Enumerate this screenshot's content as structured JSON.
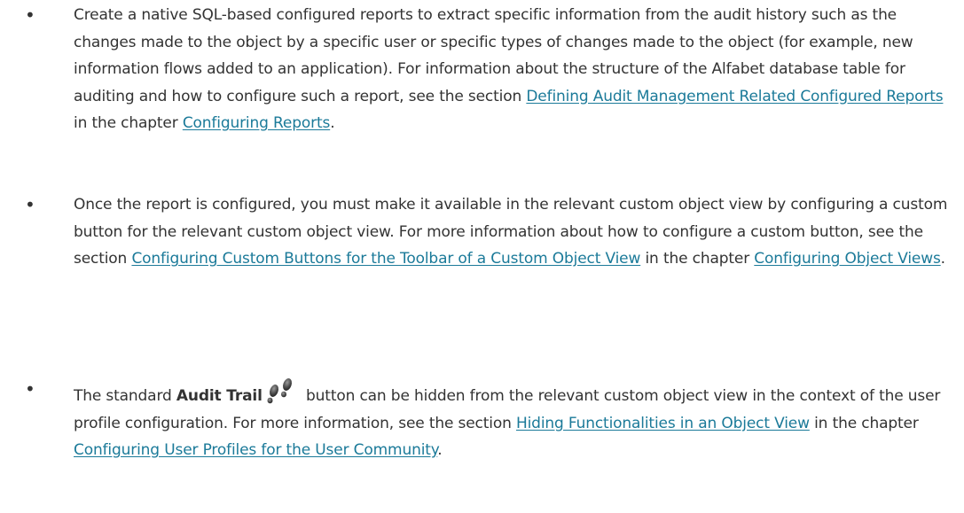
{
  "items": [
    {
      "parts": {
        "t1": "Create a native SQL-based configured reports to extract specific information from the audit history such as the changes made to the object by a specific user or specific types of changes made to the object (for example, new information flows added to an application). For information about the structure of the Alfabet database table for auditing and how to configure such a report, see the section ",
        "link1": "Defining Audit Management Related Configured Reports",
        "t2": " in the chapter ",
        "link2": "Configuring Reports",
        "t3": "."
      }
    },
    {
      "parts": {
        "t1": "Once the report is configured, you must make it available in the relevant custom object view by configuring a custom button for the relevant custom object view. For more information about how to configure a custom button, see the section ",
        "link1": "Configuring Custom Buttons for the Toolbar of a Custom Object View",
        "t2": " in the chapter ",
        "link2": "Configuring Object Views",
        "t3": "."
      }
    },
    {
      "parts": {
        "t0": "The standard ",
        "bold": "Audit Trail",
        "t1": " button can be hidden from the relevant custom object view in the context of the user profile configuration. For more information, see the section ",
        "link1": "Hiding Functionalities in an Object View",
        "t2": " in the chapter ",
        "link2": "Configuring User Profiles for the User Community",
        "t3": "."
      },
      "icon": "audit-trail-footprints-icon"
    }
  ],
  "bullet_char": "•",
  "colors": {
    "text": "#333333",
    "link": "#1b7a99"
  }
}
